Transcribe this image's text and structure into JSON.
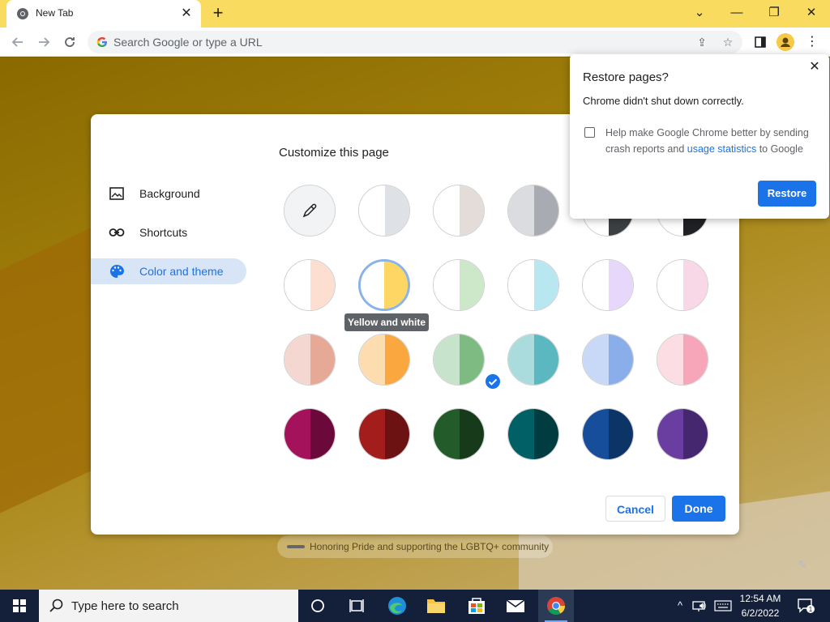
{
  "browser": {
    "tab_title": "New Tab",
    "tab_close": "✕",
    "new_tab": "+",
    "window_controls": {
      "minimize": "—",
      "restore": "❐",
      "close": "✕",
      "dropdown": "⌄"
    },
    "omnibox_placeholder": "Search Google or type a URL"
  },
  "customize": {
    "title": "Customize this page",
    "nav": [
      {
        "label": "Background",
        "icon": "image-icon"
      },
      {
        "label": "Shortcuts",
        "icon": "link-icon"
      },
      {
        "label": "Color and theme",
        "icon": "palette-icon",
        "active": true
      }
    ],
    "tooltip": "Yellow and white",
    "cancel_label": "Cancel",
    "done_label": "Done",
    "selected_theme": "Yellow and white",
    "swatch_colors": [
      [
        "#f1f3f4",
        "#f1f3f4"
      ],
      [
        "#ffffff",
        "#dee1e6"
      ],
      [
        "#ffffff",
        "#e3dcd9"
      ],
      [
        "#dadce0",
        "#a8abb2"
      ],
      [
        "#ffffff",
        "#3c4043"
      ],
      [
        "#ffffff",
        "#202124"
      ],
      [
        "#ffffff",
        "#fddfd1"
      ],
      [
        "#ffffff",
        "#fdd663"
      ],
      [
        "#ffffff",
        "#cce8c9"
      ],
      [
        "#ffffff",
        "#b8e6f1"
      ],
      [
        "#ffffff",
        "#e6d7fb"
      ],
      [
        "#ffffff",
        "#f8d7e6"
      ],
      [
        "#f5d7d1",
        "#e5a996"
      ],
      [
        "#fddcb0",
        "#f9a73e"
      ],
      [
        "#c8e3cb",
        "#7ebb82"
      ],
      [
        "#abdcdd",
        "#5cb8c0"
      ],
      [
        "#c7d9f7",
        "#8aaee9"
      ],
      [
        "#fcdde4",
        "#f7a6b9"
      ],
      [
        "#a3125a",
        "#6b0a3a"
      ],
      [
        "#a31d1d",
        "#6c1212"
      ],
      [
        "#235b2a",
        "#173a1b"
      ],
      [
        "#006066",
        "#003c40"
      ],
      [
        "#164e9c",
        "#0d3466"
      ],
      [
        "#6a3ea1",
        "#452770"
      ]
    ]
  },
  "restore": {
    "title": "Restore pages?",
    "message": "Chrome didn't shut down correctly.",
    "help_prefix": "Help make Google Chrome better by sending crash reports and ",
    "help_link": "usage statistics",
    "help_suffix": " to Google",
    "button": "Restore",
    "close": "✕"
  },
  "page": {
    "pride_text": "Honoring Pride and supporting the LGBTQ+ community"
  },
  "taskbar": {
    "search_text": "Type here to search",
    "time": "12:54 AM",
    "date": "6/2/2022",
    "notification_count": "1"
  },
  "colors": {
    "accent": "#1a73e8",
    "titlebar": "#f8db5f",
    "taskbar": "#14203a"
  }
}
